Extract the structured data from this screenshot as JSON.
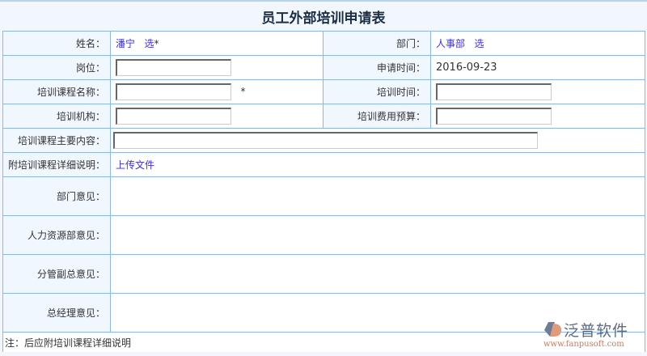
{
  "title": "员工外部培训申请表",
  "rows": {
    "name_label": "姓名：",
    "name_value": "潘宁",
    "name_select": "选",
    "required": "*",
    "dept_label": "部门：",
    "dept_value": "人事部",
    "dept_select": "选",
    "position_label": "岗位：",
    "position_value": "",
    "apply_time_label": "申请时间：",
    "apply_time_value": "2016-09-23",
    "course_label": "培训课程名称：",
    "course_value": "",
    "train_time_label": "培训时间：",
    "train_time_value": "",
    "org_label": "培训机构：",
    "org_value": "",
    "budget_label": "培训费用预算：",
    "budget_value": "",
    "content_label": "培训课程主要内容：",
    "content_value": "",
    "attach_label": "附培训课程详细说明：",
    "attach_link": "上传文件",
    "dept_opinion_label": "部门意见：",
    "hr_opinion_label": "人力资源部意见：",
    "vp_opinion_label": "分管副总意见：",
    "gm_opinion_label": "总经理意见："
  },
  "note": "注：后应附培训课程详细说明",
  "logo": {
    "name": "泛普软件",
    "url": "www.fanpusoft.com"
  }
}
